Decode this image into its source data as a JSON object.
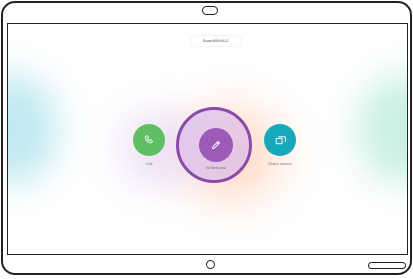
{
  "device_name": "Board55W412",
  "actions": {
    "call": {
      "label": "Call",
      "icon": "phone-icon"
    },
    "whiteboard": {
      "label": "Whiteboard",
      "icon": "pencil-icon",
      "selected": true
    },
    "share": {
      "label": "Share screen",
      "icon": "share-screen-icon"
    }
  },
  "colors": {
    "call": "#5fbf62",
    "whiteboard": "#9c5bb7",
    "whiteboard_ring": "#8a4ba8",
    "share": "#17a9b9"
  }
}
